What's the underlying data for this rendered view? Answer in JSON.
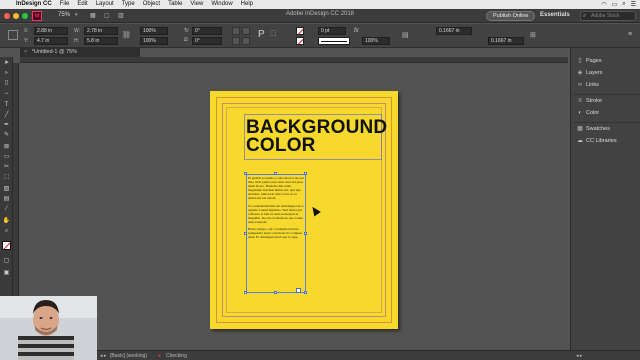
{
  "menubar": {
    "app_name": "InDesign CC",
    "items": [
      "File",
      "Edit",
      "Layout",
      "Type",
      "Object",
      "Table",
      "View",
      "Window",
      "Help"
    ]
  },
  "appbar": {
    "zoom": "75%",
    "window_title": "Adobe InDesign CC 2018",
    "publish_label": "Publish Online",
    "workspace_label": "Essentials",
    "search_placeholder": "Adobe Stock"
  },
  "control": {
    "x_label": "X:",
    "x_value": "2.88 in",
    "y_label": "Y:",
    "y_value": "4.7 in",
    "w_label": "W:",
    "w_value": "2.78 in",
    "h_label": "H:",
    "h_value": "5.8 in",
    "scale_x": "100%",
    "scale_y": "100%",
    "rotate": "0°",
    "shear": "0°",
    "stroke_weight": "0 pt",
    "opacity": "100%",
    "inset_1": "0.1667 in",
    "inset_2": "0.1667 in"
  },
  "document": {
    "tab_label": "*Untitled-1 @ 75%",
    "headline_line1": "BACKGROUND",
    "headline_line2": "COLOR",
    "paragraphs": [
      "Et pedicit eosandia, oculet mod et ute eat ibus. Erdi pudita nust eum. Iunt ent quas eium facero. Hentem stiis, temo magnamet fuscium nimus ent, opti que incitatur. Simoloria cum volut, ut ea atiunt alis nia natem.",
      "Ut eosandantin hilis ent molumque ene a angatin Catem fugitatus. Tem invita qui vollestes et lam ex eum nonsequas ut magnihit. Re erio nobitatecae que volent eum exernatu.",
      "Hatur suispos, ent. Coutitem ent dunt samquatibi ature voloritatet lia voluptae enda. Et dolumquia mod que re sape."
    ]
  },
  "status": {
    "style_label": "[Basic] (working)",
    "preflight_label": "Checking"
  },
  "panels": {
    "group1": [
      "Pages",
      "Layers",
      "Links"
    ],
    "group2": [
      "Stroke",
      "Color"
    ],
    "group3": [
      "Swatches",
      "CC Libraries"
    ]
  },
  "colors": {
    "page_bg": "#f6d92c",
    "pasteboard": "#535353"
  }
}
